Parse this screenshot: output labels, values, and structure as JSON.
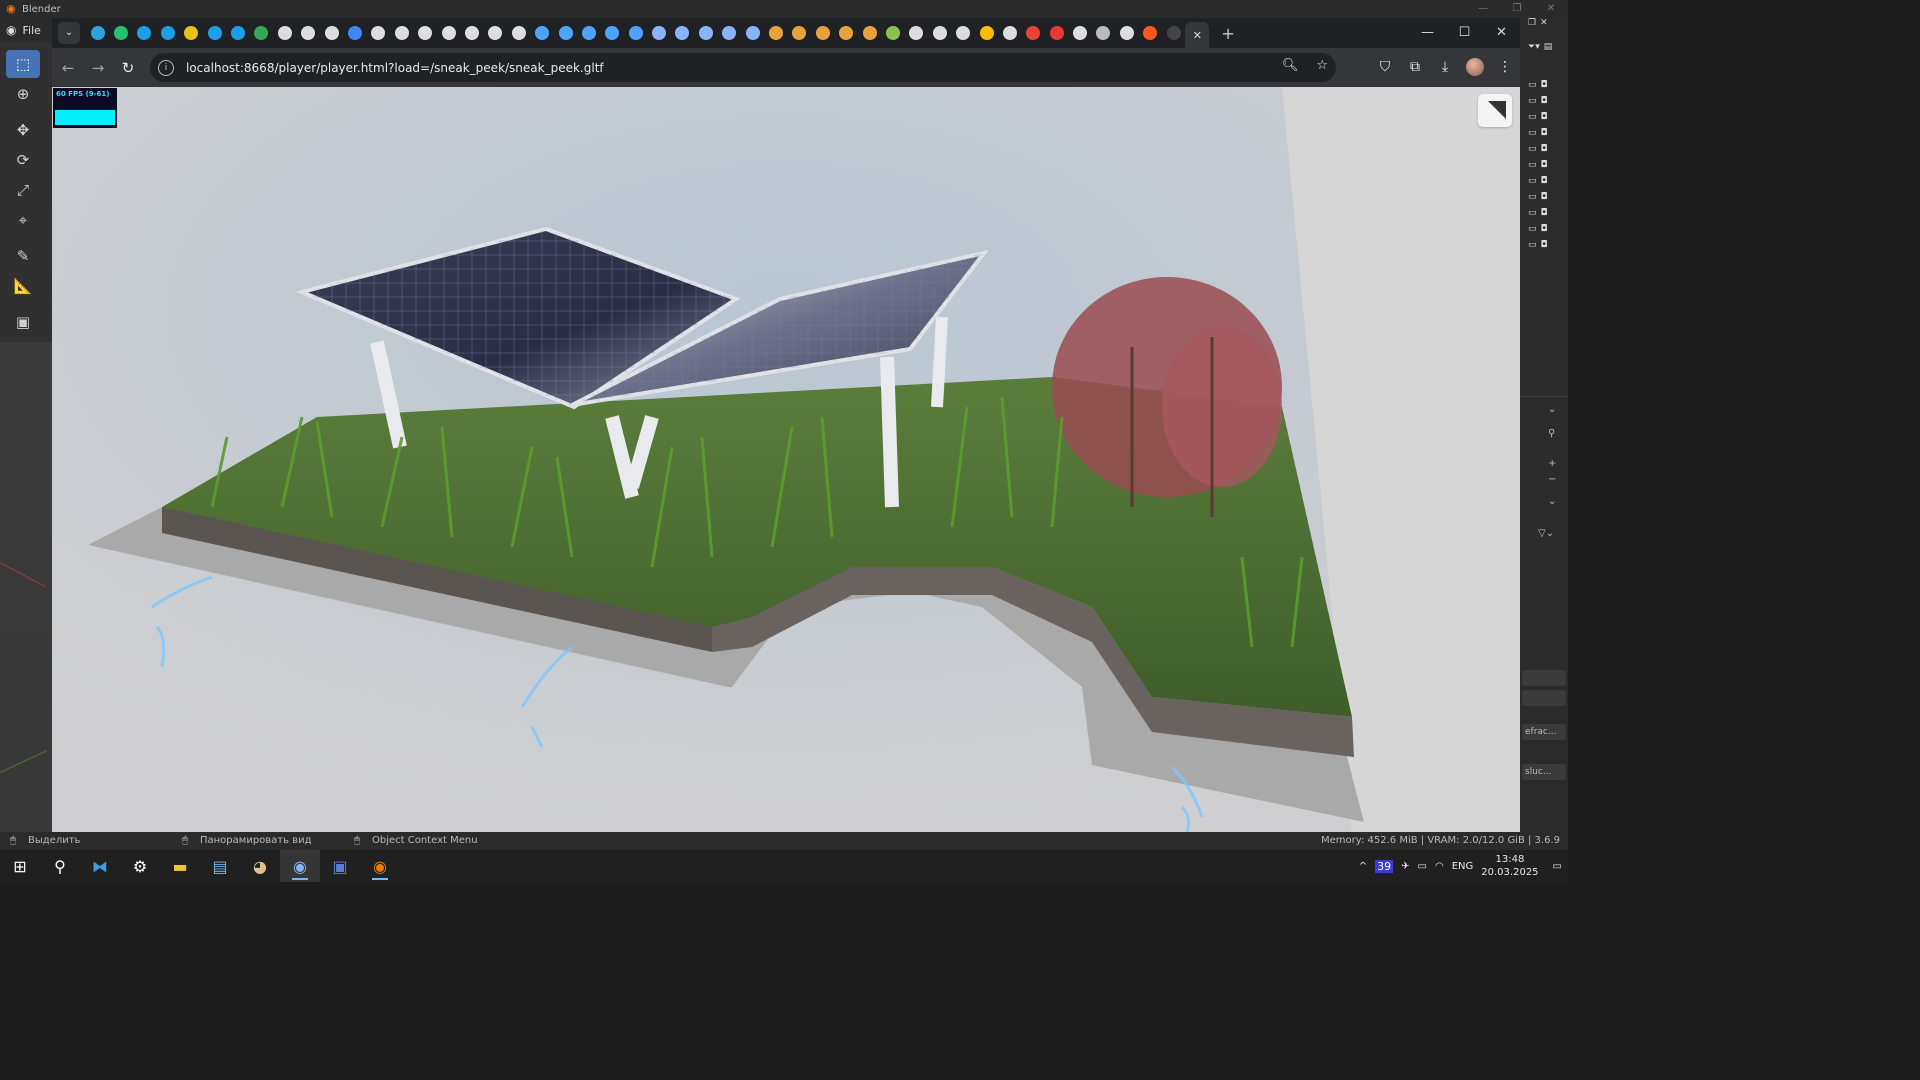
{
  "blender": {
    "title": "Blender",
    "menu_file": "File",
    "status": {
      "select": "Выделить",
      "pan_view": "Панорамировать вид",
      "context_menu": "Object Context Menu",
      "memory": "Memory: 452.6 MiB | VRAM: 2.0/12.0 GiB | 3.6.9"
    },
    "right_panel": {
      "prop_refrac": "efrac...",
      "prop_transluc": "sluc..."
    }
  },
  "browser": {
    "url": "localhost:8668/player/player.html?load=/sneak_peek/sneak_peek.gltf",
    "tab_count": 54
  },
  "viewport": {
    "fps_label": "60 FPS (9-61)",
    "fps_bar_color": "#00f0ff"
  },
  "taskbar": {
    "notification_count": "39",
    "language": "ENG",
    "time": "13:48",
    "date": "20.03.2025"
  }
}
